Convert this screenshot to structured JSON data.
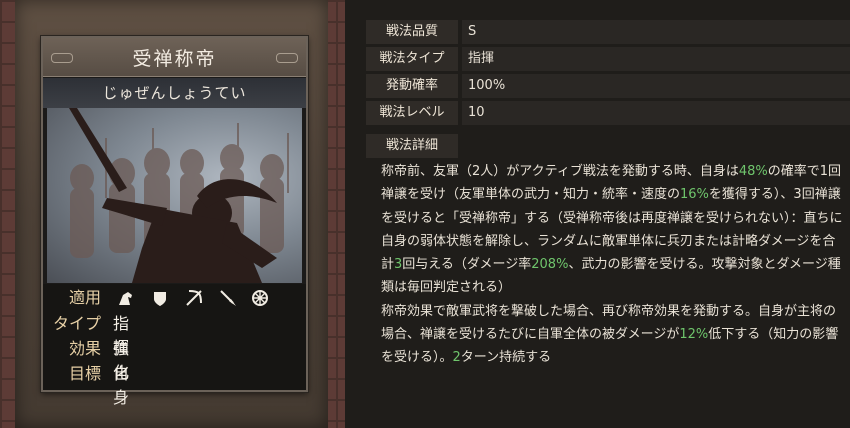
{
  "card": {
    "title": "受禅称帝",
    "reading": "じゅぜんしょうてい",
    "stats": [
      {
        "label": "適用",
        "value": ""
      },
      {
        "label": "タイプ",
        "value": "指揮"
      },
      {
        "label": "効果",
        "value": "強化"
      },
      {
        "label": "目標",
        "value": "自身"
      }
    ],
    "applicable_icons": [
      "cavalry-icon",
      "shield-icon",
      "bow-icon",
      "spear-icon",
      "wheel-icon"
    ]
  },
  "info": {
    "quality_label": "戦法品質",
    "quality_value": "S",
    "type_label": "戦法タイプ",
    "type_value": "指揮",
    "rate_label": "発動確率",
    "rate_value": "100%",
    "level_label": "戦法レベル",
    "level_value": "10"
  },
  "detail": {
    "label": "戦法詳細",
    "p1": "称帝前、友軍（2人）がアクティブ戦法を発動する時、自身は",
    "p1_g1": "48%",
    "p2": "の確率で1回禅譲を受け（友軍単体の武力・知力・統率・速度の",
    "p2_g1": "16%",
    "p3": "を獲得する）、3回禅譲を受けると「受禅称帝」する（受禅称帝後は再度禅譲を受けられない）：直ちに自身の弱体状態を解除し、ランダムに敵軍単体に兵刃または計略ダメージを合計",
    "p3_g1": "3",
    "p4": "回与える（ダメージ率",
    "p4_g1": "208%",
    "p5": "、武力の影響を受ける。攻撃対象とダメージ種類は毎回判定される）",
    "p6": "称帝効果で敵軍武将を撃破した場合、再び称帝効果を発動する。自身が主将の場合、禅譲を受けるたびに自軍全体の被ダメージが",
    "p6_g1": "12%",
    "p7": "低下する（知力の影響を受ける）。",
    "p7_g1": "2",
    "p8": "ターン持続する"
  },
  "colors": {
    "accent_green": "#6fc56c",
    "label_gold": "#e7d0a6"
  }
}
